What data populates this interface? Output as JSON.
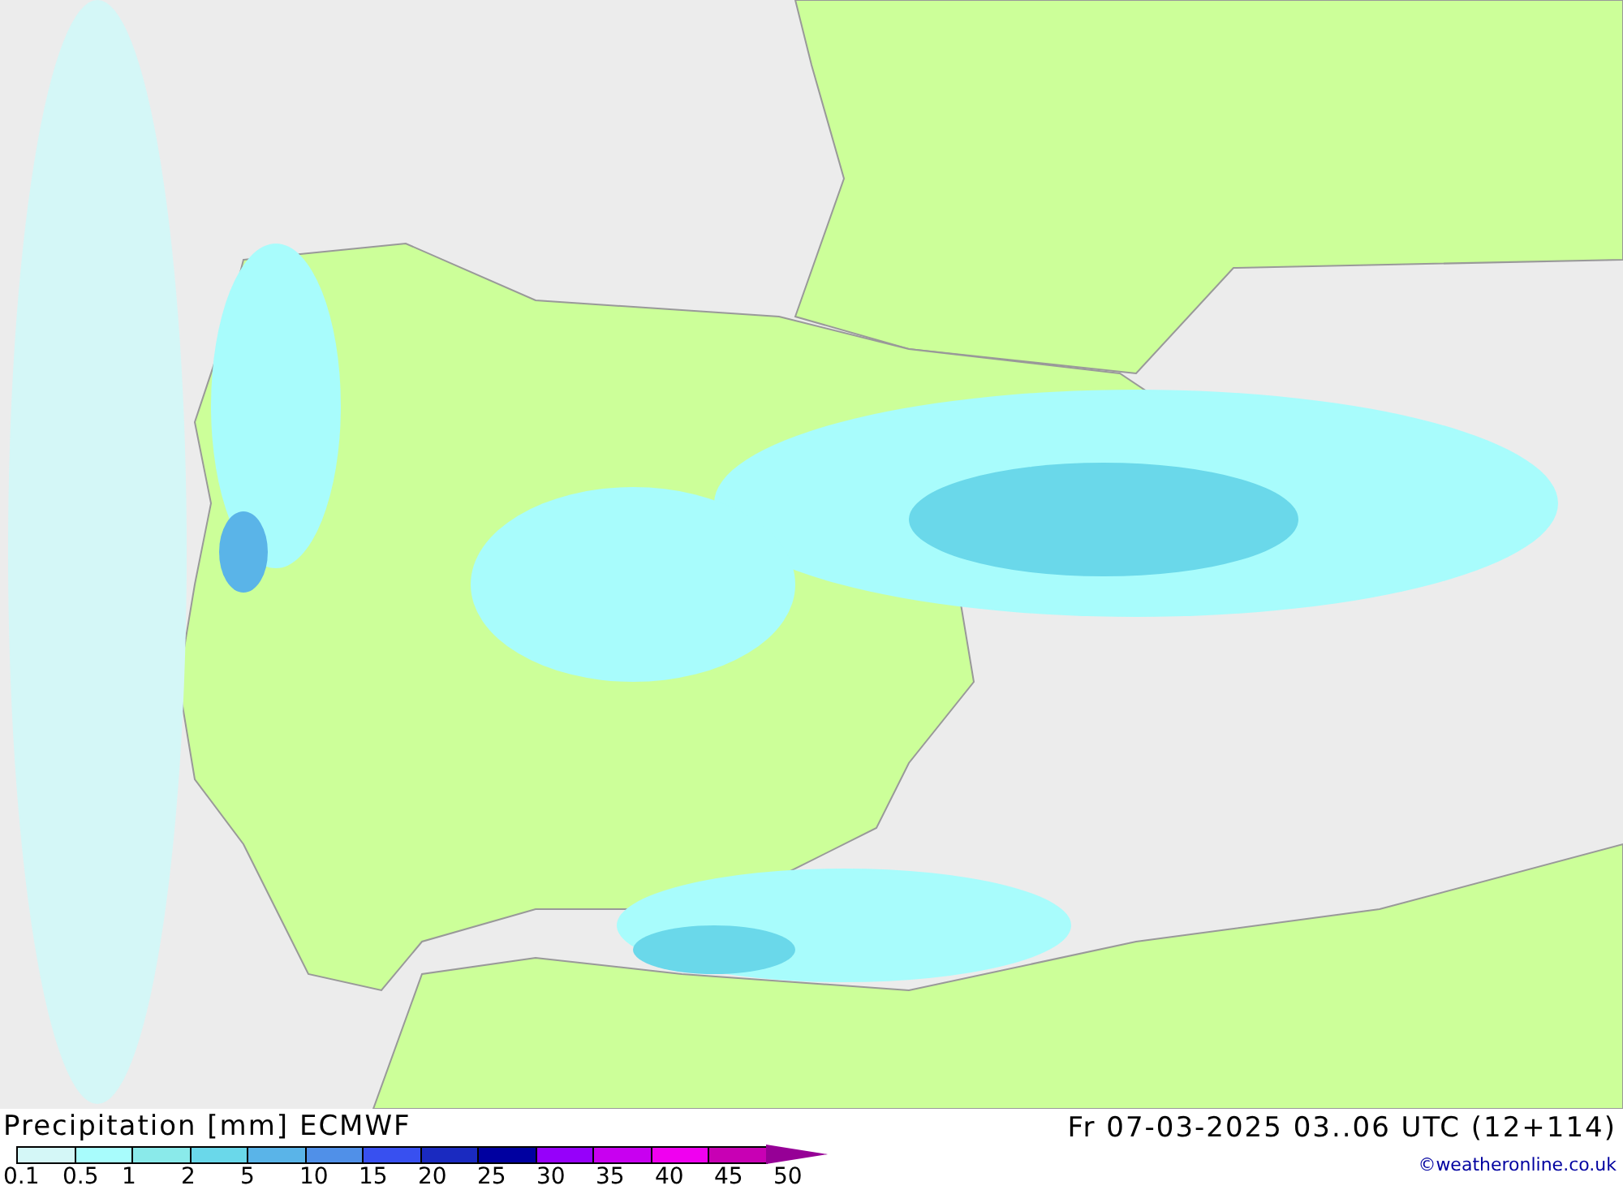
{
  "footer": {
    "title": "Precipitation [mm] ECMWF",
    "valid_time": "Fr 07-03-2025 03..06 UTC (12+114)",
    "credit": "©weatheronline.co.uk"
  },
  "legend": [
    {
      "label": "0.1",
      "color": "#d4f7f7"
    },
    {
      "label": "0.5",
      "color": "#a8fcfc"
    },
    {
      "label": "1",
      "color": "#8aeaea"
    },
    {
      "label": "2",
      "color": "#6ad8ea"
    },
    {
      "label": "5",
      "color": "#5ab4e8"
    },
    {
      "label": "10",
      "color": "#5090e8"
    },
    {
      "label": "15",
      "color": "#3850f0"
    },
    {
      "label": "20",
      "color": "#1a2ac0"
    },
    {
      "label": "25",
      "color": "#0000a0"
    },
    {
      "label": "30",
      "color": "#9600fa"
    },
    {
      "label": "35",
      "color": "#c800f0"
    },
    {
      "label": "40",
      "color": "#f000f0"
    },
    {
      "label": "45",
      "color": "#c800b4"
    },
    {
      "label": "50",
      "color": "#960096"
    }
  ]
}
